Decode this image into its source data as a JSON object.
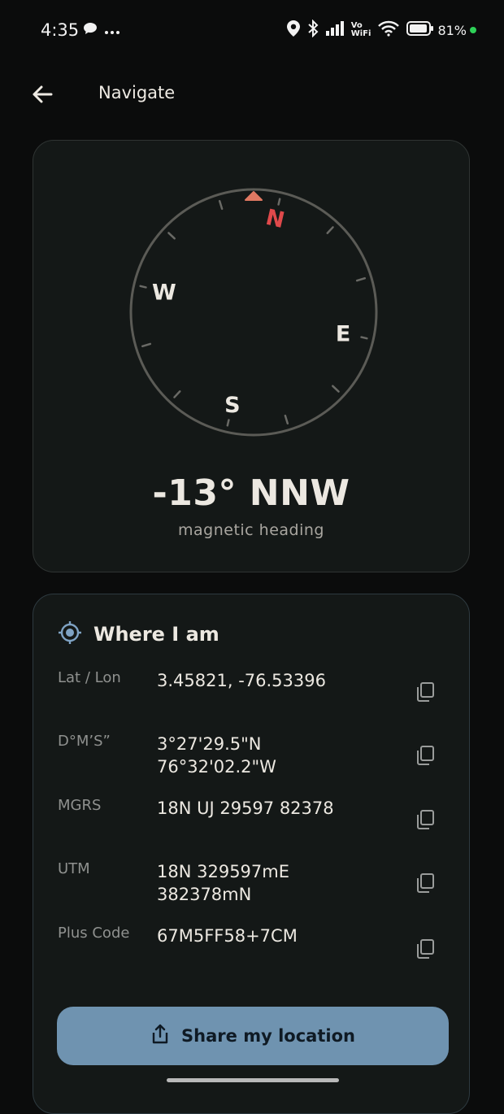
{
  "status_bar": {
    "time": "4:35",
    "vowifi_top": "Vo",
    "vowifi_bottom": "WiFi",
    "battery": "81%",
    "icons": [
      "chat-bubble-icon",
      "more-dots-icon",
      "location-pin-icon",
      "bluetooth-icon",
      "signal-icon",
      "wifi-icon",
      "battery-icon"
    ]
  },
  "app_bar": {
    "title": "Navigate",
    "back_icon": "arrow-left-icon"
  },
  "compass": {
    "heading": "-13° NNW",
    "heading_label": "magnetic heading",
    "rotation_deg": 13,
    "cardinals": {
      "n": "N",
      "e": "E",
      "s": "S",
      "w": "W"
    },
    "colors": {
      "north": "#e0494b",
      "marker": "#e07862",
      "ring": "#5b5b56",
      "ticks": "#6a6a66"
    }
  },
  "location": {
    "title": "Where I am",
    "rows": [
      {
        "label": "Lat / Lon",
        "value": "3.45821, -76.53396"
      },
      {
        "label": "D°M’S”",
        "value": "3°27'29.5\"N\n76°32'02.2\"W"
      },
      {
        "label": "MGRS",
        "value": "18N UJ 29597 82378"
      },
      {
        "label": "UTM",
        "value": "18N 329597mE\n382378mN"
      },
      {
        "label": "Plus Code",
        "value": "67M5FF58+7CM"
      }
    ],
    "share_label": "Share my location",
    "accent": "#6f93b0"
  }
}
